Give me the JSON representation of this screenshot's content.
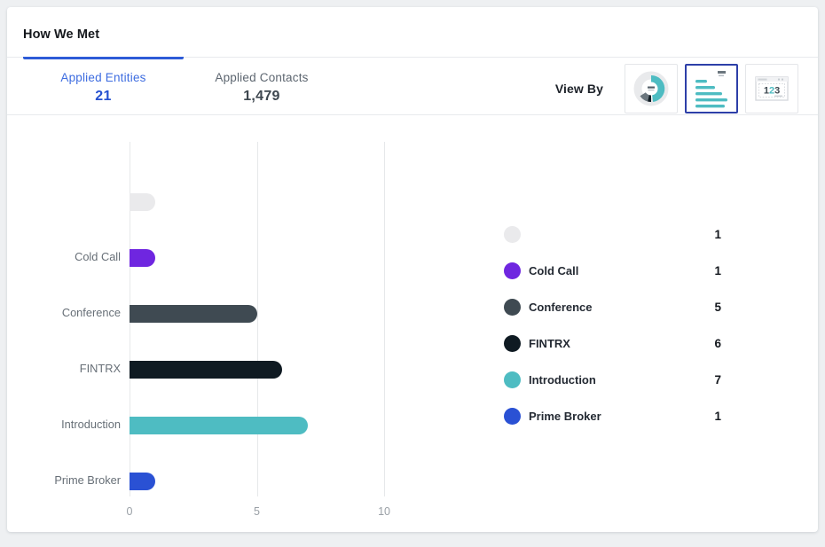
{
  "card": {
    "title": "How We Met"
  },
  "tabs": [
    {
      "label": "Applied Entities",
      "value": "21",
      "active": true,
      "name": "tab-applied-entities"
    },
    {
      "label": "Applied Contacts",
      "value": "1,479",
      "active": false,
      "name": "tab-applied-contacts"
    }
  ],
  "viewby": {
    "label": "View By",
    "options": [
      {
        "icon": "donut-chart-icon",
        "name": "view-by-donut-chart-button",
        "selected": false
      },
      {
        "icon": "bar-chart-icon",
        "name": "view-by-bar-chart-button",
        "selected": true
      },
      {
        "icon": "number-table-icon",
        "name": "view-by-numbers-button",
        "selected": false
      }
    ]
  },
  "colors": {
    "blank": "#eaeaec",
    "cold_call": "#6f26e0",
    "conference": "#3f4a52",
    "fintrx": "#0f1a22",
    "introduction": "#4ebcc2",
    "prime_broker": "#2a51d4",
    "accent_blue": "#2d5bd7",
    "gridline": "#e6e8ea",
    "page_background": "#eef0f2",
    "card_background": "#ffffff"
  },
  "chart_data": {
    "type": "bar",
    "orientation": "horizontal",
    "title": "How We Met",
    "xlabel": "",
    "ylabel": "",
    "xlim": [
      0,
      10.8
    ],
    "xticks": [
      0,
      5,
      10
    ],
    "xtick_labels": [
      "0",
      "5",
      "10"
    ],
    "grid": true,
    "legend_position": "right",
    "categories": [
      "",
      "Cold Call",
      "Conference",
      "FINTRX",
      "Introduction",
      "Prime Broker"
    ],
    "values": [
      1,
      1,
      5,
      6,
      7,
      1
    ],
    "colors": [
      "#eaeaec",
      "#6f26e0",
      "#3f4a52",
      "#0f1a22",
      "#4ebcc2",
      "#2a51d4"
    ],
    "total": 21
  },
  "legend": {
    "items": [
      {
        "label": "",
        "value": "1",
        "color": "#eaeaec"
      },
      {
        "label": "Cold Call",
        "value": "1",
        "color": "#6f26e0"
      },
      {
        "label": "Conference",
        "value": "5",
        "color": "#3f4a52"
      },
      {
        "label": "FINTRX",
        "value": "6",
        "color": "#0f1a22"
      },
      {
        "label": "Introduction",
        "value": "7",
        "color": "#4ebcc2"
      },
      {
        "label": "Prime Broker",
        "value": "1",
        "color": "#2a51d4"
      }
    ]
  }
}
